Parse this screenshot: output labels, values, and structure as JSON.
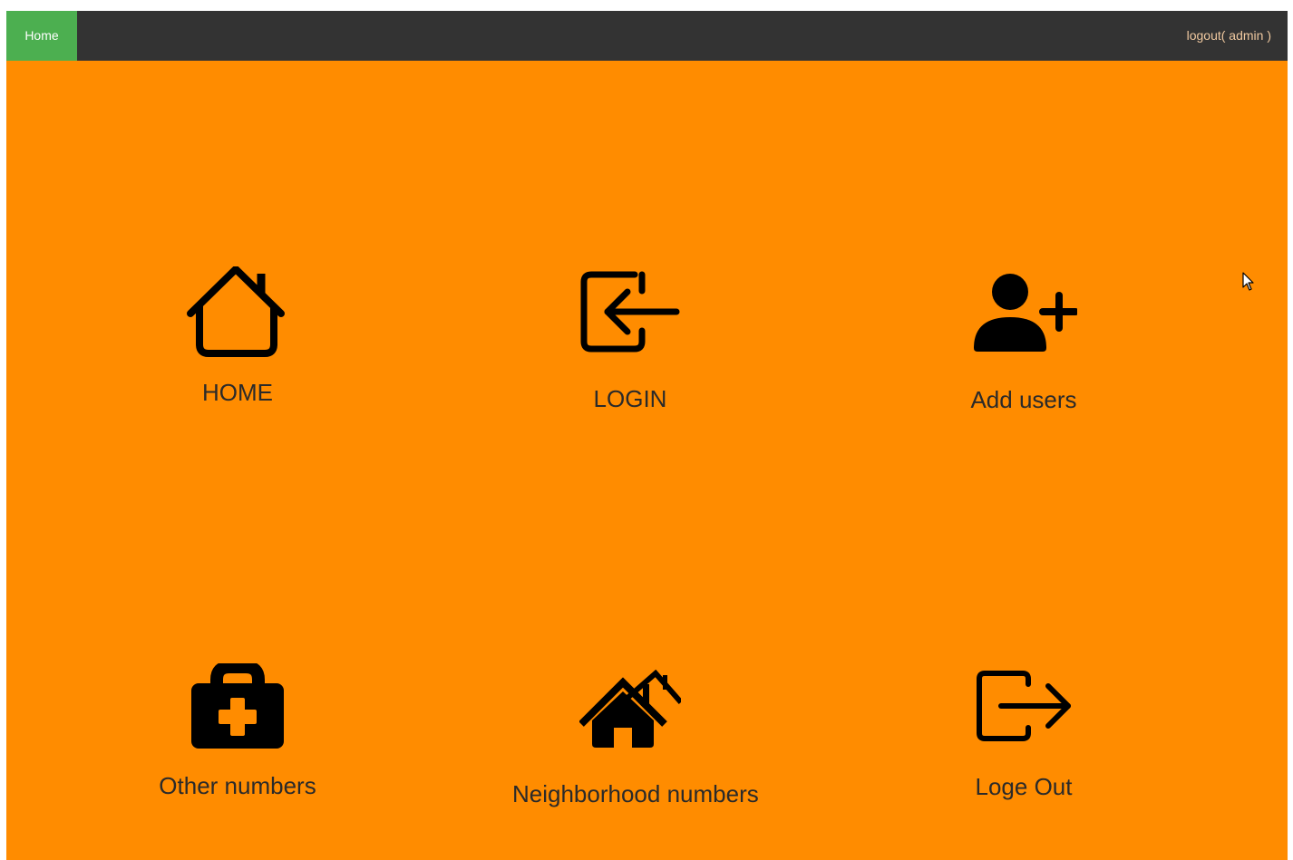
{
  "nav": {
    "home_label": "Home",
    "logout_label": "logout( admin )"
  },
  "tiles": [
    {
      "label": "HOME",
      "icon": "home-icon"
    },
    {
      "label": "LOGIN",
      "icon": "login-icon"
    },
    {
      "label": "Add users",
      "icon": "add-user-icon"
    },
    {
      "label": "Other numbers",
      "icon": "medical-kit-icon"
    },
    {
      "label": "Neighborhood numbers",
      "icon": "houses-icon"
    },
    {
      "label": "Loge Out",
      "icon": "logout-icon"
    }
  ],
  "colors": {
    "background": "#ff8c00",
    "navbar": "#333333",
    "home_active": "#4caf50"
  }
}
